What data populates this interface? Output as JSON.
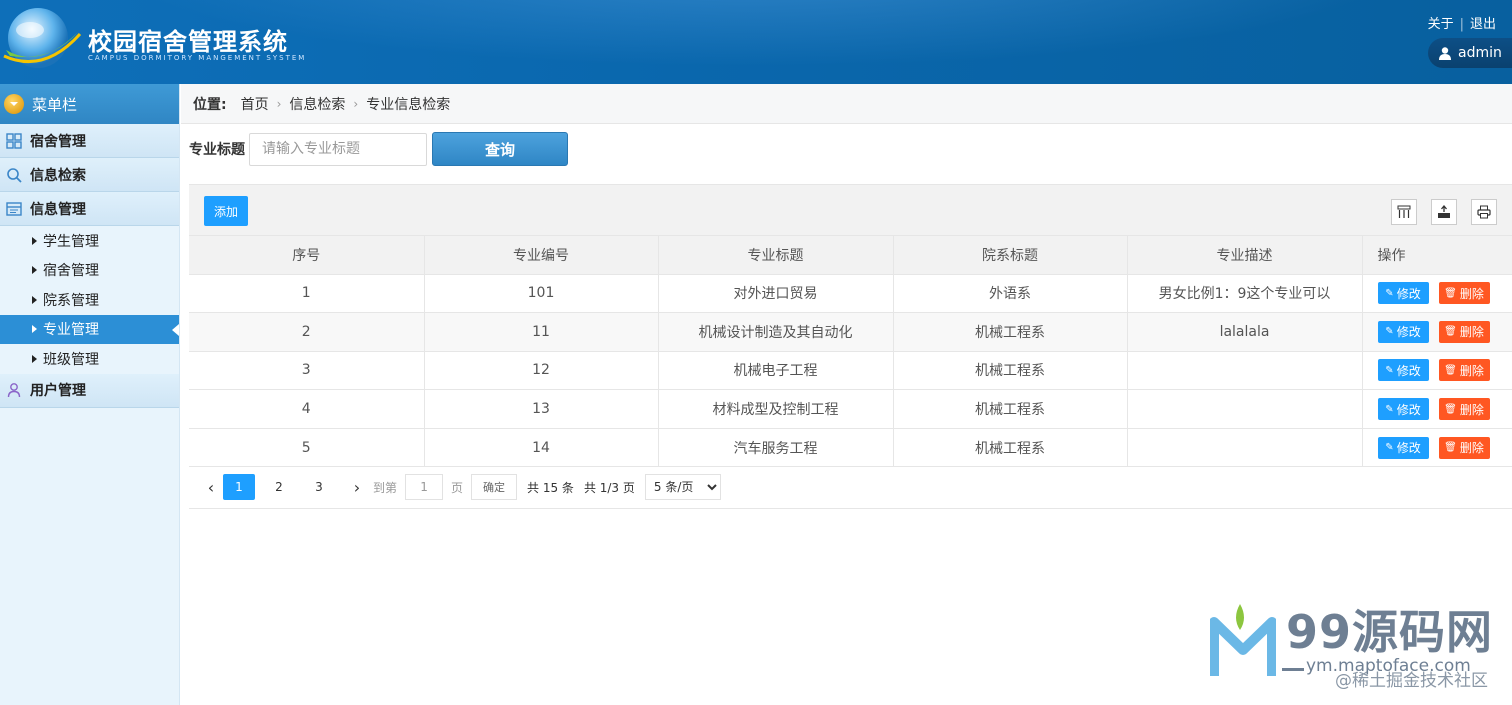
{
  "header": {
    "title": "校园宿舍管理系统",
    "subtitle": "CAMPUS DORMITORY MANGEMENT SYSTEM",
    "links": [
      "关于",
      "退出"
    ],
    "user": "admin"
  },
  "sidebar": {
    "head": "菜单栏",
    "groups": {
      "dorm": "宿舍管理",
      "search": "信息检索",
      "info": "信息管理",
      "user": "用户管理"
    },
    "items": [
      "学生管理",
      "宿舍管理",
      "院系管理",
      "专业管理",
      "班级管理"
    ],
    "active_item": "专业管理"
  },
  "breadcrumb": {
    "label": "位置:",
    "items": [
      "首页",
      "信息检索",
      "专业信息检索"
    ]
  },
  "search": {
    "label": "专业标题",
    "placeholder": "请输入专业标题",
    "button": "查询"
  },
  "toolbar": {
    "add": "添加"
  },
  "table": {
    "columns": [
      "序号",
      "专业编号",
      "专业标题",
      "院系标题",
      "专业描述",
      "操作"
    ],
    "rows": [
      [
        "1",
        "101",
        "对外进口贸易",
        "外语系",
        "男女比例1：9这个专业可以"
      ],
      [
        "2",
        "11",
        "机械设计制造及其自动化",
        "机械工程系",
        "lalalala"
      ],
      [
        "3",
        "12",
        "机械电子工程",
        "机械工程系",
        ""
      ],
      [
        "4",
        "13",
        "材料成型及控制工程",
        "机械工程系",
        ""
      ],
      [
        "5",
        "14",
        "汽车服务工程",
        "机械工程系",
        ""
      ]
    ],
    "edit_label": "修改",
    "delete_label": "删除"
  },
  "pager": {
    "pages": [
      "1",
      "2",
      "3"
    ],
    "current": "1",
    "goto_label": "到第",
    "goto_value": "1",
    "page_unit": "页",
    "confirm": "确定",
    "total": "共 15 条",
    "total_pages": "共 1/3 页",
    "page_size": "5 条/页"
  },
  "watermark": {
    "brand": "99源码网",
    "url": "ym.maptoface.com",
    "community": "@稀土掘金技术社区"
  },
  "colors": {
    "header_blue": "#0a67ad",
    "primary": "#1e9fff",
    "danger": "#ff5722",
    "sidebar_active": "#2c8fd6"
  }
}
